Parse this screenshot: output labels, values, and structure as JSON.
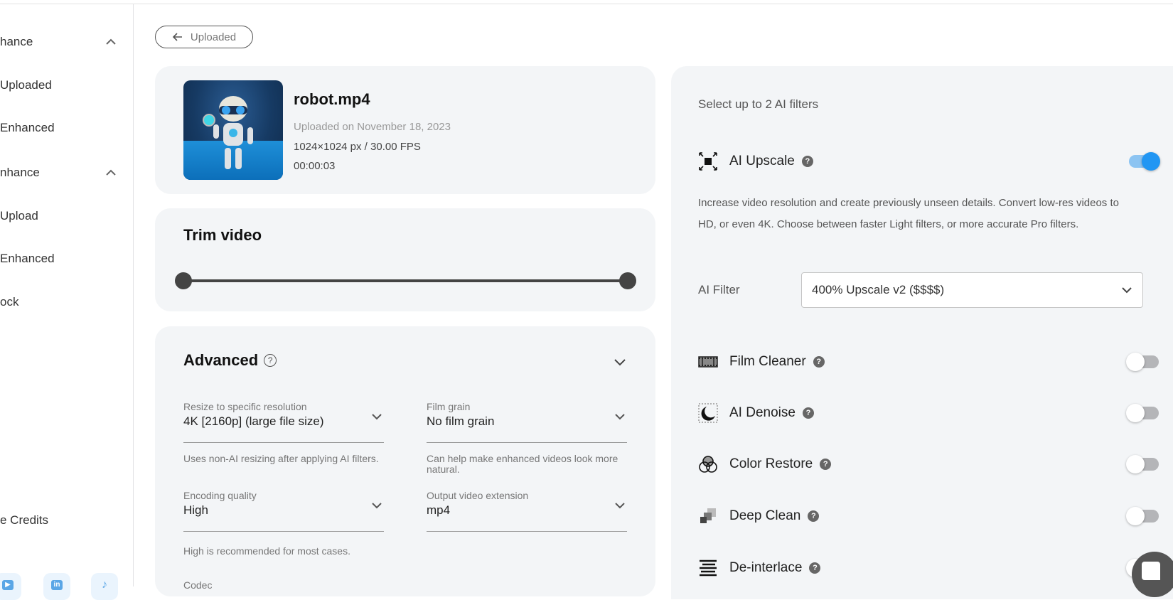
{
  "sidebar": {
    "items": [
      {
        "label": "hance",
        "expandable": true
      },
      {
        "label": "Uploaded"
      },
      {
        "label": "Enhanced"
      },
      {
        "label": "nhance",
        "expandable": true
      },
      {
        "label": "Upload"
      },
      {
        "label": "Enhanced"
      },
      {
        "label": "ock"
      },
      {
        "label": "e Credits"
      }
    ],
    "social": [
      {
        "icon": "youtube-icon",
        "glyph": "▶"
      },
      {
        "icon": "linkedin-icon",
        "glyph": "in"
      },
      {
        "icon": "tiktok-icon",
        "glyph": "♪"
      }
    ]
  },
  "back_button": {
    "label": "Uploaded"
  },
  "file": {
    "name": "robot.mp4",
    "uploaded": "Uploaded on November 18, 2023",
    "resolution_fps": "1024×1024 px / 30.00 FPS",
    "duration": "00:00:03"
  },
  "trim": {
    "title": "Trim video",
    "start_fraction": 0.0,
    "end_fraction": 1.0
  },
  "advanced": {
    "title": "Advanced",
    "help": "?",
    "fields": [
      {
        "label": "Resize to specific resolution",
        "value": "4K [2160p] (large file size)",
        "help": "Uses non-AI resizing after applying AI filters."
      },
      {
        "label": "Film grain",
        "value": "No film grain",
        "help": "Can help make enhanced videos look more natural."
      },
      {
        "label": "Encoding quality",
        "value": "High",
        "help": "High is recommended for most cases."
      },
      {
        "label": "Output video extension",
        "value": "mp4",
        "help": ""
      }
    ],
    "codec_label": "Codec"
  },
  "filters": {
    "hint": "Select up to 2 AI filters",
    "ai_upscale": {
      "name": "AI Upscale",
      "enabled": true,
      "description": "Increase video resolution and create previously unseen details. Convert low-res videos to HD, or even 4K. Choose between faster Light filters, or more accurate Pro filters.",
      "filter_label": "AI Filter",
      "filter_value": "400% Upscale v2 ($$$$)"
    },
    "others": [
      {
        "name": "Film Cleaner",
        "enabled": false
      },
      {
        "name": "AI Denoise",
        "enabled": false
      },
      {
        "name": "Color Restore",
        "enabled": false
      },
      {
        "name": "Deep Clean",
        "enabled": false
      },
      {
        "name": "De-interlace",
        "enabled": false
      }
    ],
    "help_glyph": "?"
  },
  "colors": {
    "accent": "#2196f3",
    "accent_light": "#8cc4f2",
    "card_bg": "#f3f5f7",
    "toggle_off": "#b4b5b8"
  }
}
